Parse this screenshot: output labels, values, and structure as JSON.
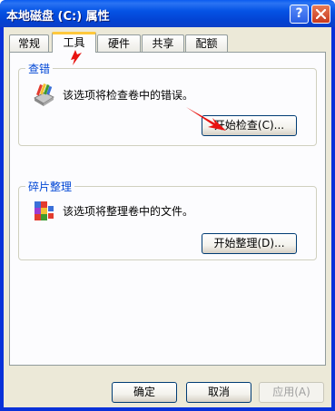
{
  "window": {
    "title": "本地磁盘 (C:) 属性"
  },
  "titlebar": {
    "help_glyph": "?",
    "close_glyph": "×"
  },
  "tabs": [
    {
      "label": "常规",
      "active": false
    },
    {
      "label": "工具",
      "active": true
    },
    {
      "label": "硬件",
      "active": false
    },
    {
      "label": "共享",
      "active": false
    },
    {
      "label": "配额",
      "active": false
    }
  ],
  "error_check": {
    "group_label": "查错",
    "description": "该选项将检查卷中的错误。",
    "button_label": "开始检查(C)..."
  },
  "defrag": {
    "group_label": "碎片整理",
    "description": "该选项将整理卷中的文件。",
    "button_label": "开始整理(D)..."
  },
  "footer": {
    "ok_label": "确定",
    "cancel_label": "取消",
    "apply_label": "应用(A)"
  },
  "colors": {
    "titlebar": "#0553e5",
    "dialog_bg": "#ece9d8",
    "group_label": "#0046d5",
    "annotation_arrow": "#e8130f",
    "active_tab_highlight": "#ffc83c"
  }
}
